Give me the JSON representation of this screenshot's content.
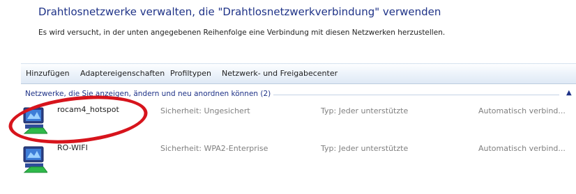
{
  "header": {
    "title": "Drahtlosnetzwerke verwalten, die \"Drahtlosnetzwerkverbindung\" verwenden",
    "subtitle": "Es wird versucht, in der unten angegebenen Reihenfolge eine Verbindung mit diesen Netzwerken herzustellen."
  },
  "toolbar": {
    "add": "Hinzufügen",
    "adapter": "Adaptereigenschaften",
    "profiles": "Profiltypen",
    "network_center": "Netzwerk- und Freigabecenter",
    "help": "?"
  },
  "group": {
    "label": "Netzwerke, die Sie anzeigen, ändern und neu anordnen können (2)",
    "collapse": "▲"
  },
  "networks": [
    {
      "name": "rocam4_hotspot",
      "security": "Sicherheit: Ungesichert",
      "type": "Typ: Jeder unterstützte",
      "mode": "Automatisch verbind..."
    },
    {
      "name": "RO-WIFI",
      "security": "Sicherheit: WPA2-Enterprise",
      "type": "Typ: Jeder unterstützte",
      "mode": "Automatisch verbind..."
    }
  ],
  "annotation": {
    "color": "#d7141c"
  },
  "colors": {
    "title": "#1e3287",
    "muted": "#7f7f7f"
  }
}
